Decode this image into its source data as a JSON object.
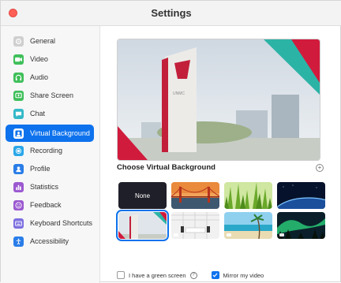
{
  "window": {
    "title": "Settings"
  },
  "sidebar": {
    "items": [
      {
        "label": "General",
        "icon": "gear-icon",
        "color": "#b0b0b0"
      },
      {
        "label": "Video",
        "icon": "video-camera-icon",
        "color": "#3fbf5a"
      },
      {
        "label": "Audio",
        "icon": "headphones-icon",
        "color": "#3fbf5a"
      },
      {
        "label": "Share Screen",
        "icon": "share-screen-icon",
        "color": "#3fbf5a"
      },
      {
        "label": "Chat",
        "icon": "chat-bubble-icon",
        "color": "#33b9c8"
      },
      {
        "label": "Virtual Background",
        "icon": "portrait-icon",
        "color": "#ffffff",
        "active": true
      },
      {
        "label": "Recording",
        "icon": "record-icon",
        "color": "#2aa7e8"
      },
      {
        "label": "Profile",
        "icon": "profile-icon",
        "color": "#2a7de8"
      },
      {
        "label": "Statistics",
        "icon": "bar-chart-icon",
        "color": "#9b59d0"
      },
      {
        "label": "Feedback",
        "icon": "smiley-icon",
        "color": "#9b59d0"
      },
      {
        "label": "Keyboard Shortcuts",
        "icon": "keyboard-icon",
        "color": "#7c6fe0"
      },
      {
        "label": "Accessibility",
        "icon": "accessibility-icon",
        "color": "#2a7de8"
      }
    ]
  },
  "main": {
    "section_title": "Choose Virtual Background",
    "thumbnails": [
      {
        "label": "None"
      },
      {
        "name": "golden-gate-bridge"
      },
      {
        "name": "grass"
      },
      {
        "name": "earth-from-space"
      },
      {
        "name": "campus-sign",
        "selected": true
      },
      {
        "name": "office-interior"
      },
      {
        "name": "beach"
      },
      {
        "name": "aurora"
      }
    ],
    "green_screen_label": "I have a green screen",
    "green_screen_checked": false,
    "mirror_label": "Mirror my video",
    "mirror_checked": true
  },
  "colors": {
    "accent": "#0e72ed",
    "close": "#ff5f57"
  }
}
